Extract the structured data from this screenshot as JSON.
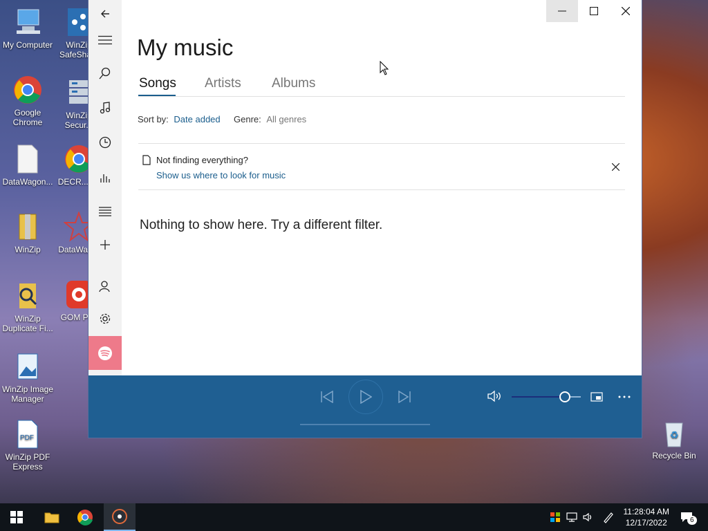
{
  "desktop": {
    "icons": [
      {
        "label": "My Computer"
      },
      {
        "label": "WinZip SafeSha..."
      },
      {
        "label": "Google Chrome"
      },
      {
        "label": "WinZip Secur..."
      },
      {
        "label": "DataWagon..."
      },
      {
        "label": "DECR...P..."
      },
      {
        "label": "WinZip"
      },
      {
        "label": "DataWag..."
      },
      {
        "label": "WinZip Duplicate Fi..."
      },
      {
        "label": "GOM Pl..."
      },
      {
        "label": "WinZip Image Manager"
      },
      {
        "label": "WinZip PDF Express"
      },
      {
        "label": "Recycle Bin"
      }
    ]
  },
  "app": {
    "title": "My music",
    "tabs": [
      {
        "label": "Songs"
      },
      {
        "label": "Artists"
      },
      {
        "label": "Albums"
      }
    ],
    "sort_label": "Sort by:",
    "sort_value": "Date added",
    "genre_label": "Genre:",
    "genre_value": "All genres",
    "notice_title": "Not finding everything?",
    "notice_link": "Show us where to look for music",
    "empty_text": "Nothing to show here. Try a different filter.",
    "volume_level": 0.76,
    "accent": "#1f5f92"
  },
  "taskbar": {
    "time": "11:28:04 AM",
    "date": "12/17/2022",
    "notifications": "6"
  }
}
